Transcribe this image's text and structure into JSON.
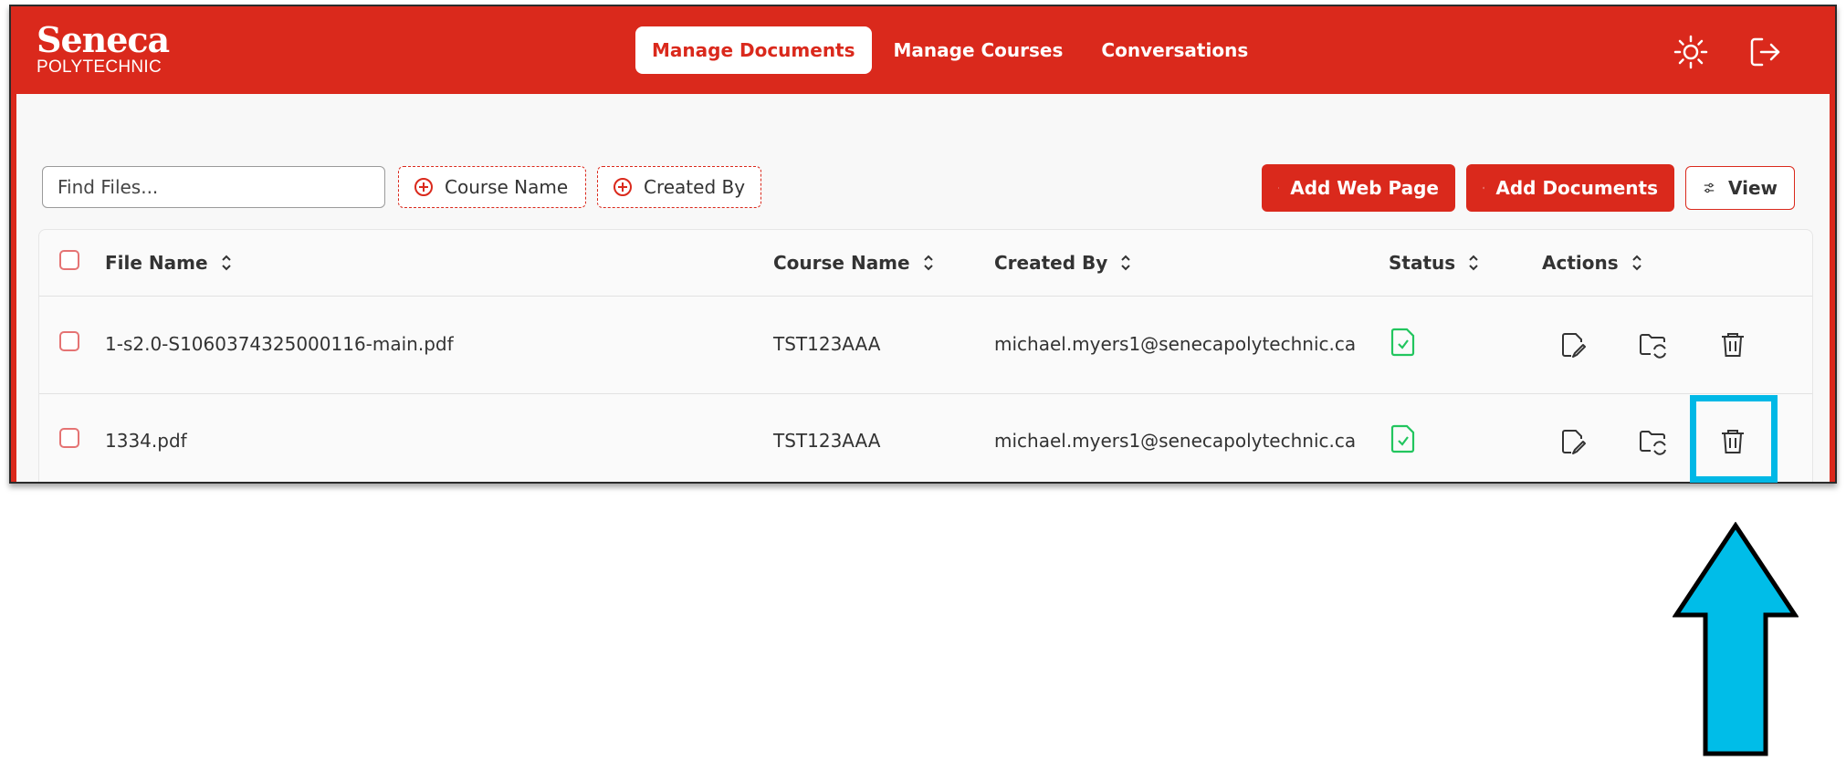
{
  "brand": {
    "name": "Seneca",
    "sub": "POLYTECHNIC"
  },
  "nav": {
    "tabs": [
      {
        "label": "Manage Documents",
        "active": true
      },
      {
        "label": "Manage Courses",
        "active": false
      },
      {
        "label": "Conversations",
        "active": false
      }
    ]
  },
  "toolbar": {
    "search_placeholder": "Find Files...",
    "filters": [
      "Course Name",
      "Created By"
    ],
    "add_web_page": "Add Web Page",
    "add_documents": "Add Documents",
    "view": "View"
  },
  "table": {
    "columns": [
      "File Name",
      "Course Name",
      "Created By",
      "Status",
      "Actions"
    ],
    "rows": [
      {
        "file": "1-s2.0-S1060374325000116-main.pdf",
        "course": "TST123AAA",
        "creator": "michael.myers1@senecapolytechnic.ca",
        "status": "processed"
      },
      {
        "file": "1334.pdf",
        "course": "TST123AAA",
        "creator": "michael.myers1@senecapolytechnic.ca",
        "status": "processed"
      }
    ]
  },
  "colors": {
    "brand_red": "#da291c",
    "highlight_cyan": "#00b8e6",
    "status_green": "#22c55e"
  },
  "icons": [
    "sun-icon",
    "logout-icon",
    "plus-circle-icon",
    "globe-icon",
    "sliders-icon",
    "sort-icon",
    "file-check-icon",
    "edit-file-icon",
    "folder-sync-icon",
    "trash-icon"
  ]
}
